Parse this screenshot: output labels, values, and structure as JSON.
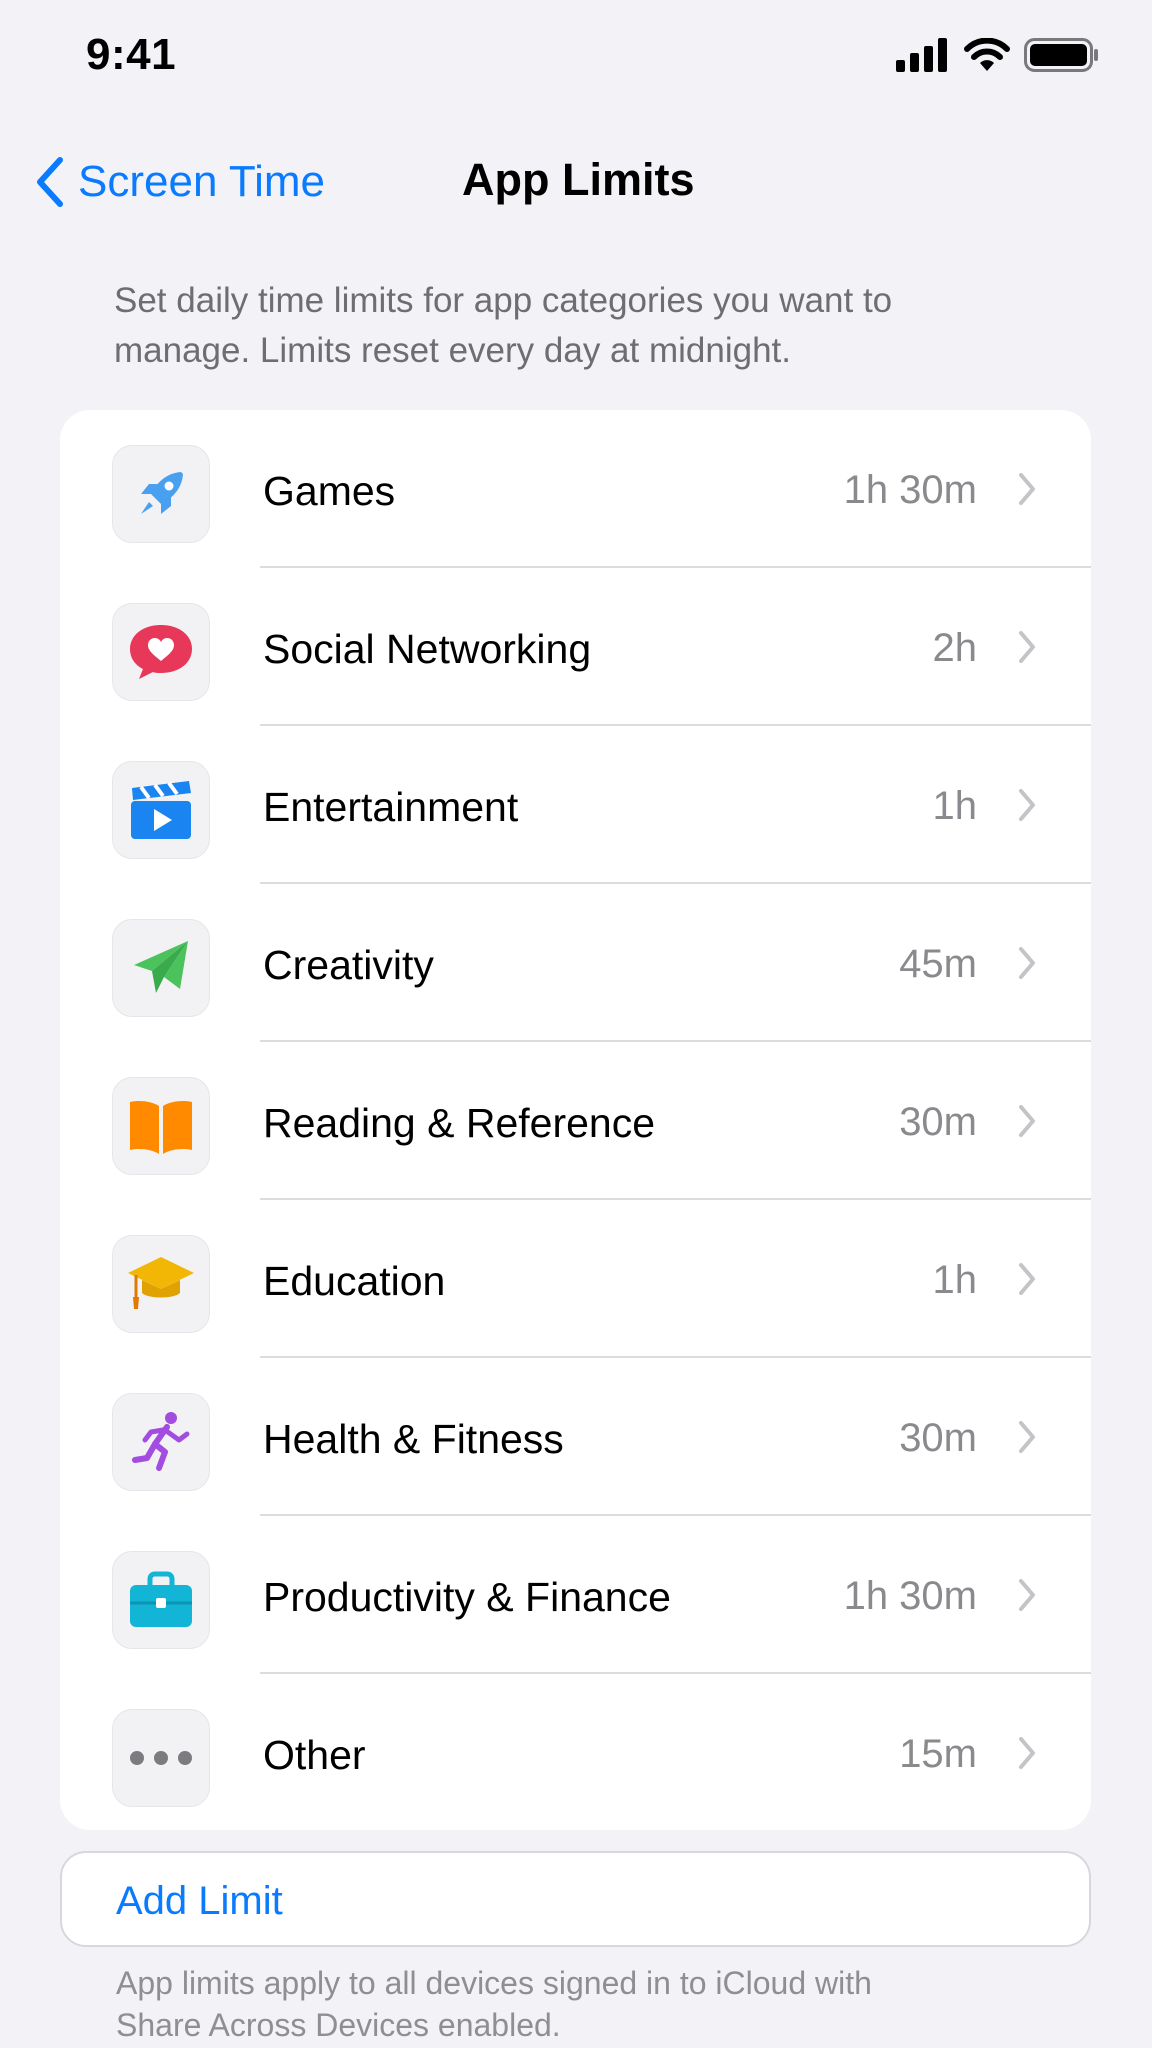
{
  "status_bar": {
    "time": "9:41"
  },
  "nav": {
    "back_label": "Screen Time",
    "title": "App Limits"
  },
  "intro_text": "Set daily time limits for app categories you want to manage. Limits reset every day at midnight.",
  "categories": [
    {
      "label": "Games",
      "value": "1h 30m",
      "icon": "rocket-icon",
      "color": "#4aa0f0"
    },
    {
      "label": "Social Networking",
      "value": "2h",
      "icon": "heart-bubble-icon",
      "color": "#e8385a"
    },
    {
      "label": "Entertainment",
      "value": "1h",
      "icon": "clapperboard-icon",
      "color": "#1a84f0"
    },
    {
      "label": "Creativity",
      "value": "45m",
      "icon": "paper-plane-icon",
      "color": "#4cc25c"
    },
    {
      "label": "Reading & Reference",
      "value": "30m",
      "icon": "book-icon",
      "color": "#ff8a00"
    },
    {
      "label": "Education",
      "value": "1h",
      "icon": "graduation-cap-icon",
      "color": "#f2b705"
    },
    {
      "label": "Health & Fitness",
      "value": "30m",
      "icon": "running-figure-icon",
      "color": "#a24ce0"
    },
    {
      "label": "Productivity & Finance",
      "value": "1h 30m",
      "icon": "briefcase-icon",
      "color": "#12b5d6"
    },
    {
      "label": "Other",
      "value": "15m",
      "icon": "ellipsis-icon",
      "color": "#7c7c80"
    }
  ],
  "add_limit_label": "Add Limit",
  "footer_note": "App limits apply to all devices signed in to iCloud with Share Across Devices enabled.",
  "colors": {
    "accent": "#0a7aff",
    "background": "#f2f2f7",
    "secondary_text": "#8a8a8e"
  }
}
